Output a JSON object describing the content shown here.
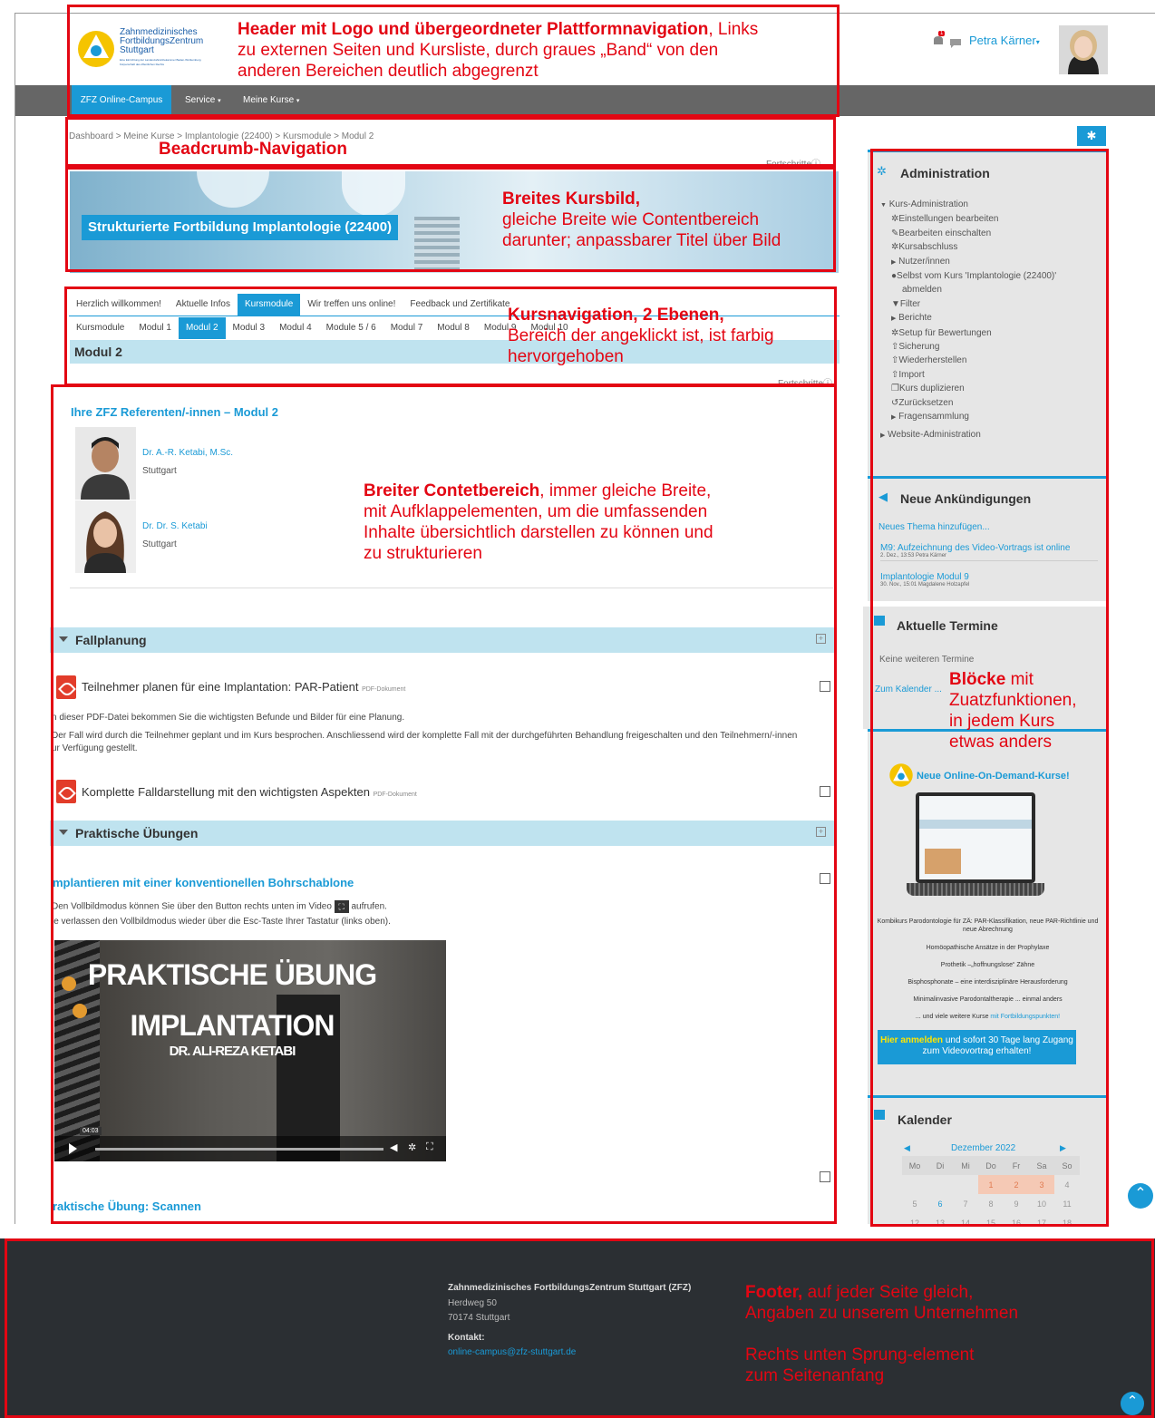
{
  "header": {
    "logo": {
      "line1": "Zahnmedizinisches",
      "line2": "FortbildungsZentrum",
      "line3": "Stuttgart",
      "tagline1": "Eine Einrichtung der Landeszahnärztekammer Baden-Württemberg",
      "tagline2": "Körperschaft des öffentlichen Rechts"
    },
    "user_name": "Petra Kärner",
    "notification_count": "1"
  },
  "nav": {
    "items": [
      "ZFZ Online-Campus",
      "Service",
      "Meine Kurse"
    ]
  },
  "breadcrumb": {
    "text": "Dashboard > Meine Kurse > Implantologie (22400) > Kursmodule > Modul 2"
  },
  "progress_label": "Fortschritte",
  "banner": {
    "title": "Strukturierte Fortbildung Implantologie (22400)"
  },
  "course_tabs": {
    "level1": [
      "Herzlich willkommen!",
      "Aktuelle Infos",
      "Kursmodule",
      "Wir treffen uns online!",
      "Feedback und Zertifikate"
    ],
    "level2": [
      "Kursmodule",
      "Modul 1",
      "Modul 2",
      "Modul 3",
      "Modul 4",
      "Module 5 / 6",
      "Modul 7",
      "Modul 8",
      "Modul 9",
      "Modul 10"
    ],
    "active_label": "Modul 2"
  },
  "content": {
    "referents_title": "Ihre ZFZ Referenten/-innen – Modul 2",
    "referents": [
      {
        "name": "Dr. A.-R. Ketabi, M.Sc.",
        "city": "Stuttgart"
      },
      {
        "name": "Dr. Dr. S. Ketabi",
        "city": "Stuttgart"
      }
    ],
    "sections": [
      {
        "title": "Fallplanung"
      },
      {
        "title": "Praktische Übungen"
      }
    ],
    "activity1": {
      "title": "Teilnehmer planen für eine Implantation: PAR-Patient",
      "type": "PDF-Dokument"
    },
    "activity1_desc1": "n dieser PDF-Datei bekommen Sie die wichtigsten Befunde und Bilder für eine Planung.",
    "activity1_desc2": "Der Fall wird durch die Teilnehmer geplant und im Kurs besprochen. Anschliessend wird der komplette Fall mit der durchgeführten Behandlung freigeschalten und den Teilnehmern/-innen",
    "activity1_desc3": "ur Verfügung gestellt.",
    "activity2": {
      "title": "Komplette Falldarstellung mit den wichtigsten Aspekten",
      "type": "PDF-Dokument"
    },
    "video_title": "mplantieren mit einer konventionellen Bohrschablone",
    "video_hint1a": "Den Vollbildmodus können Sie über den Button rechts unten im Video",
    "video_hint1b": "aufrufen.",
    "video_hint2": "ie verlassen den Vollbildmodus wieder über die Esc-Taste Ihrer Tastatur (links oben).",
    "video": {
      "line1": "PRAKTISCHE ÜBUNG",
      "line2": "IMPLANTATION",
      "line3": "DR. ALI-REZA KETABI",
      "time": "04:03"
    },
    "next_title": "raktische Übung: Scannen"
  },
  "sidebar": {
    "admin_title": "Administration",
    "admin_items": [
      "Kurs-Administration",
      "Einstellungen bearbeiten",
      "Bearbeiten einschalten",
      "Kursabschluss",
      "Nutzer/innen",
      "Selbst vom Kurs 'Implantologie (22400)'",
      "abmelden",
      "Filter",
      "Berichte",
      "Setup für Bewertungen",
      "Sicherung",
      "Wiederherstellen",
      "Import",
      "Kurs duplizieren",
      "Zurücksetzen",
      "Fragensammlung",
      "Website-Administration"
    ],
    "news_title": "Neue Ankündigungen",
    "news_add": "Neues Thema hinzufügen...",
    "news": [
      {
        "title": "M9: Aufzeichnung des Video-Vortrags ist online",
        "meta": "2. Dez., 13:53 Petra Kärner"
      },
      {
        "title": "Implantologie Modul 9",
        "meta": "30. Nov., 15:01 Magdalene Holzapfel"
      }
    ],
    "events_title": "Aktuelle Termine",
    "events_none": "Keine weiteren Termine",
    "events_link": "Zum Kalender ...",
    "promo": {
      "title": "Neue Online-On-Demand-Kurse!",
      "items": [
        "Kombikurs Parodontologie für ZÄ: PAR-Klassifikation, neue PAR-Richtlinie und neue Abrechnung",
        "Homöopathische Ansätze in der Prophylaxe",
        "Prothetik –„hoffnungslose“ Zähne",
        "Bisphosphonate – eine interdisziplinäre Herausforderung",
        "Minimalinvasive Parodontaltherapie ... einmal anders"
      ],
      "more_prefix": "... und viele weitere Kurse ",
      "more_link": "mit Fortbildungspunkten!",
      "cta_highlight": "Hier anmelden",
      "cta_rest": " und sofort 30 Tage lang Zugang zum Videovortrag erhalten!"
    },
    "calendar_title": "Kalender",
    "calendar": {
      "month": "Dezember 2022",
      "days": [
        "Mo",
        "Di",
        "Mi",
        "Do",
        "Fr",
        "Sa",
        "So"
      ],
      "rows": [
        [
          "",
          "",
          "",
          "1",
          "2",
          "3",
          "4"
        ],
        [
          "5",
          "6",
          "7",
          "8",
          "9",
          "10",
          "11"
        ],
        [
          "12",
          "13",
          "14",
          "15",
          "16",
          "17",
          "18"
        ]
      ]
    }
  },
  "footer": {
    "org": "Zahnmedizinisches FortbildungsZentrum Stuttgart (ZFZ)",
    "street": "Herdweg 50",
    "city": "70174 Stuttgart",
    "contact_label": "Kontakt:",
    "email": "online-campus@zfz-stuttgart.de"
  },
  "annotations": {
    "header_bold": "Header mit Logo und übergeordneter Plattformnavigation",
    "header_rest1": ", Links",
    "header_rest2": "zu externen Seiten und Kursliste, durch graues „Band“ von den",
    "header_rest3": "anderen Bereichen deutlich abgegrenzt",
    "breadcrumb": "Beadcrumb-Navigation",
    "banner_bold": "Breites Kursbild,",
    "banner_rest1": "gleiche Breite wie Contentbereich",
    "banner_rest2": "darunter; anpassbarer Titel über Bild",
    "tabs_bold": "Kursnavigation, 2 Ebenen,",
    "tabs_rest1": "Bereich der angeklickt ist, ist farbig",
    "tabs_rest2": "hervorgehoben",
    "content_bold": "Breiter Contetbereich",
    "content_rest1": ", immer gleiche Breite,",
    "content_rest2": "mit Aufklappelementen, um die umfassenden",
    "content_rest3": "Inhalte übersichtlich darstellen zu können und",
    "content_rest4": "zu strukturieren",
    "blocks_bold": "Blöcke",
    "blocks_rest1": " mit",
    "blocks_rest2": "Zuatzfunktionen,",
    "blocks_rest3": "in jedem Kurs",
    "blocks_rest4": "etwas anders",
    "footer_bold": "Footer,",
    "footer_rest1": " auf jeder Seite gleich,",
    "footer_rest2": "Angaben zu unserem Unternehmen",
    "footer_rest3": "Rechts unten Sprung-element",
    "footer_rest4": "zum Seitenanfang"
  },
  "colors": {
    "accent": "#1a9ad6",
    "annotation": "#e30613",
    "nav_band": "#666666",
    "footer": "#2b2f33"
  }
}
